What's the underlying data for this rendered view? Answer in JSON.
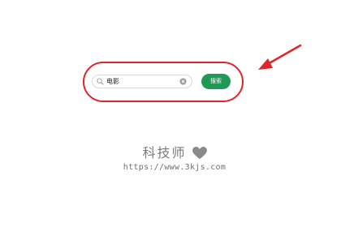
{
  "search": {
    "value": "电影",
    "button_label": "搜索"
  },
  "watermark": {
    "title": "科技师",
    "url": "https://www.3kjs.com"
  },
  "colors": {
    "button_bg": "#1f9a55",
    "annotation": "#e0242c",
    "watermark": "#7a7a7a"
  },
  "icons": {
    "search": "search-icon",
    "clear": "clear-icon",
    "heart": "heart-icon",
    "arrow": "arrow-annotation"
  }
}
